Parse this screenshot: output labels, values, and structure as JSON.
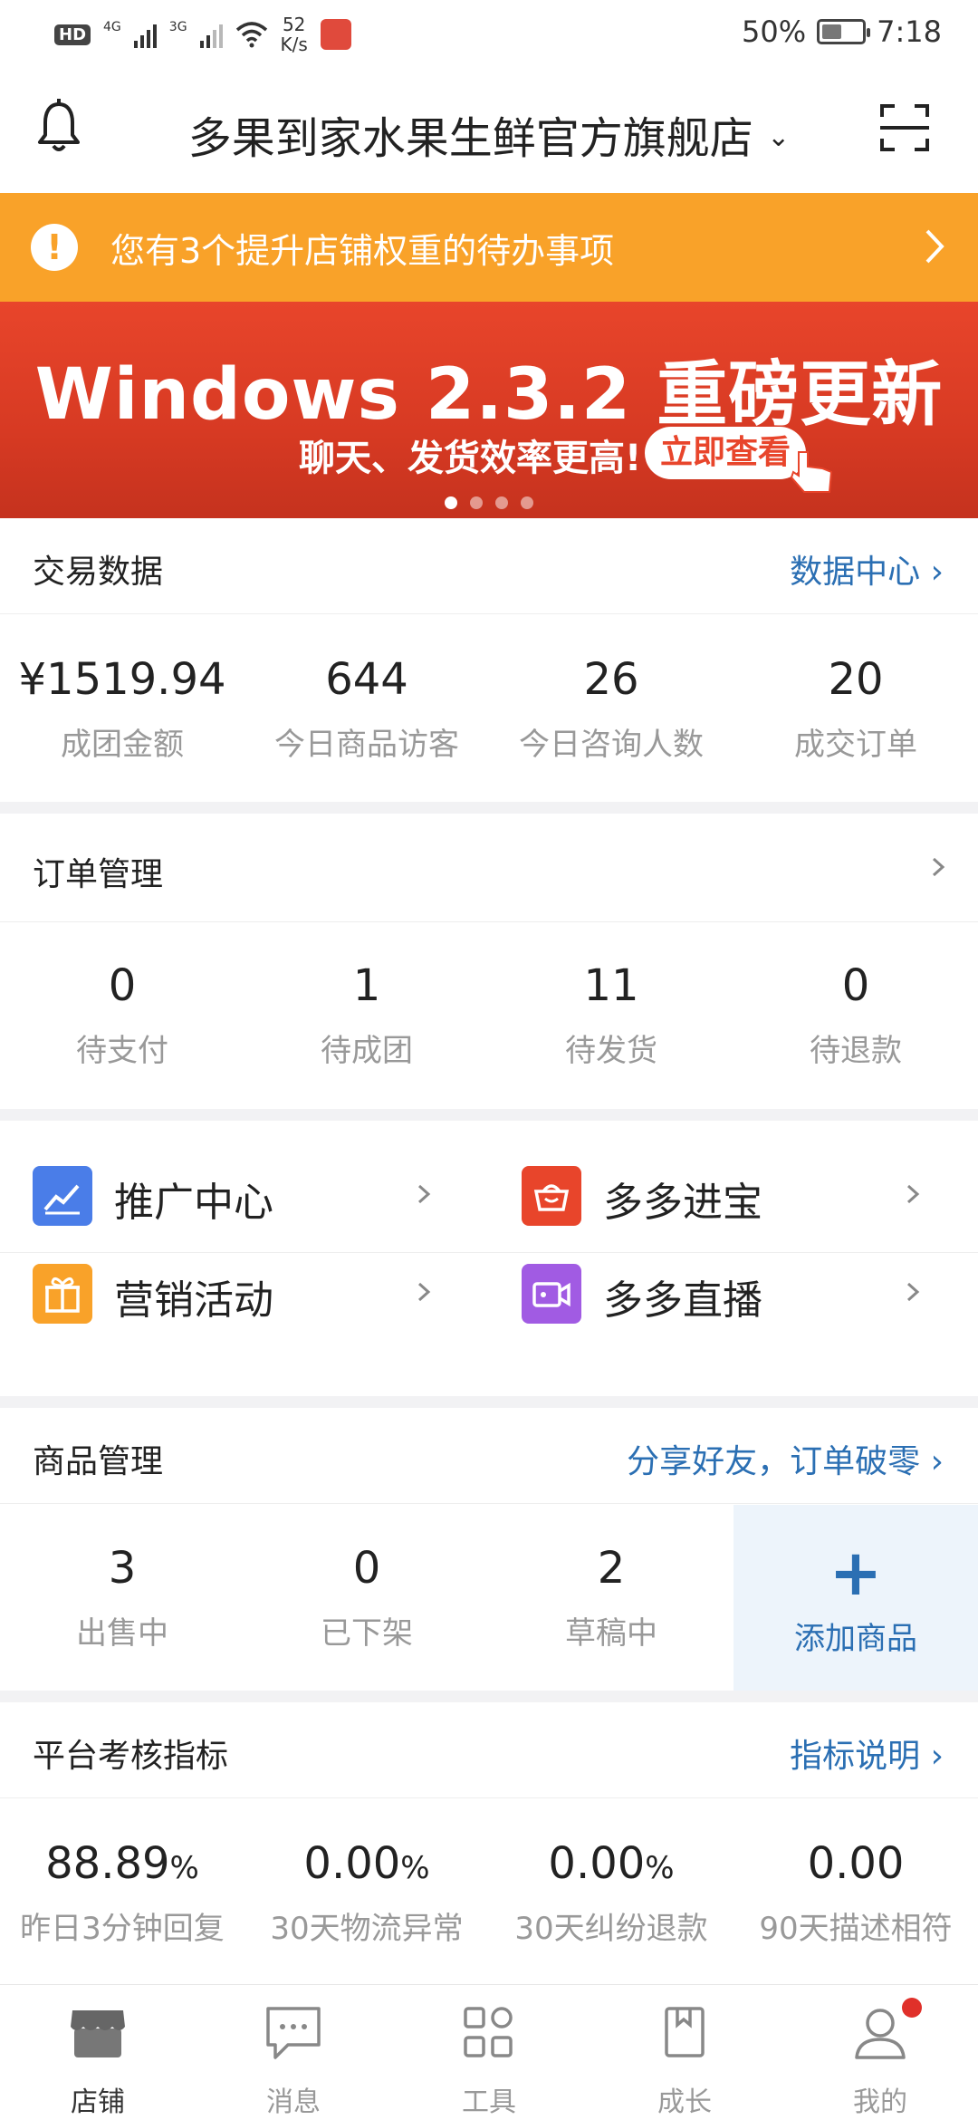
{
  "status_bar": {
    "hd": "HD",
    "net1": "4G",
    "net2": "3G",
    "speed_value": "52",
    "speed_unit": "K/s",
    "battery": "50%",
    "battery_level": 0.5,
    "time": "7:18"
  },
  "header": {
    "store_name": "多果到家水果生鲜官方旗舰店",
    "dropdown_glyph": "⌄"
  },
  "notice": {
    "text": "您有3个提升店铺权重的待办事项"
  },
  "banner": {
    "title": "Windows 2.3.2 重磅更新",
    "subtitle": "聊天、发货效率更高!",
    "button": "立即查看"
  },
  "trade": {
    "title": "交易数据",
    "link": "数据中心 ›",
    "stats": [
      {
        "value": "¥1519.94",
        "label": "成团金额"
      },
      {
        "value": "644",
        "label": "今日商品访客"
      },
      {
        "value": "26",
        "label": "今日咨询人数"
      },
      {
        "value": "20",
        "label": "成交订单"
      }
    ]
  },
  "orders": {
    "title": "订单管理",
    "stats": [
      {
        "value": "0",
        "label": "待支付"
      },
      {
        "value": "1",
        "label": "待成团"
      },
      {
        "value": "11",
        "label": "待发货"
      },
      {
        "value": "0",
        "label": "待退款"
      }
    ]
  },
  "menu": [
    {
      "label": "推广中心",
      "color": "#4a7de8"
    },
    {
      "label": "多多进宝",
      "color": "#e8452b"
    },
    {
      "label": "营销活动",
      "color": "#f9a229"
    },
    {
      "label": "多多直播",
      "color": "#a15be3"
    }
  ],
  "goods": {
    "title": "商品管理",
    "link": "分享好友，订单破零 ›",
    "stats": [
      {
        "value": "3",
        "label": "出售中"
      },
      {
        "value": "0",
        "label": "已下架"
      },
      {
        "value": "2",
        "label": "草稿中"
      }
    ],
    "add": {
      "plus": "+",
      "label": "添加商品"
    }
  },
  "metrics": {
    "title": "平台考核指标",
    "link": "指标说明 ›",
    "stats": [
      {
        "value": "88.89",
        "unit": "%",
        "label": "昨日3分钟回复"
      },
      {
        "value": "0.00",
        "unit": "%",
        "label": "30天物流异常"
      },
      {
        "value": "0.00",
        "unit": "%",
        "label": "30天纠纷退款"
      },
      {
        "value": "0.00",
        "unit": "",
        "label": "90天描述相符"
      }
    ]
  },
  "tabs": [
    {
      "label": "店铺",
      "icon": "store-icon",
      "active": true
    },
    {
      "label": "消息",
      "icon": "message-icon",
      "active": false
    },
    {
      "label": "工具",
      "icon": "tools-icon",
      "active": false
    },
    {
      "label": "成长",
      "icon": "growth-icon",
      "active": false
    },
    {
      "label": "我的",
      "icon": "profile-icon",
      "active": false
    }
  ],
  "colors": {
    "accent_blue": "#2b6fb3",
    "notice_orange": "#f9a229",
    "banner_red": "#e8452b"
  }
}
